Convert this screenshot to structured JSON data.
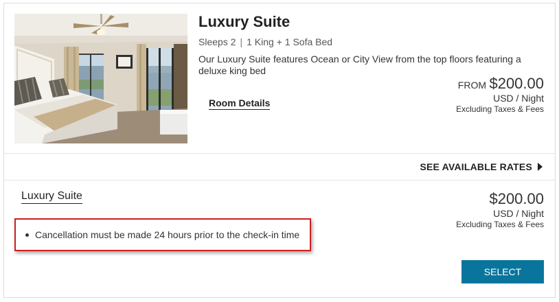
{
  "room": {
    "title": "Luxury Suite",
    "sleeps": "Sleeps 2",
    "separator": "|",
    "beds": "1 King + 1 Sofa Bed",
    "description": "Our Luxury Suite features Ocean or City View from the top floors featuring a deluxe king bed",
    "details_link": "Room Details",
    "price": {
      "from_label": "FROM",
      "amount": "$200.00",
      "unit": "USD / Night",
      "note": "Excluding Taxes & Fees"
    }
  },
  "rates_toggle": {
    "label": "SEE AVAILABLE RATES",
    "icon": "caret-right-icon"
  },
  "rate": {
    "name": "Luxury Suite",
    "policies": [
      "Cancellation must be made 24 hours prior to the check-in time"
    ],
    "price": {
      "amount": "$200.00",
      "unit": "USD / Night",
      "note": "Excluding Taxes & Fees"
    },
    "select_label": "SELECT"
  },
  "colors": {
    "select_button": "#0a759c",
    "highlight_border": "#cc1f1f"
  }
}
